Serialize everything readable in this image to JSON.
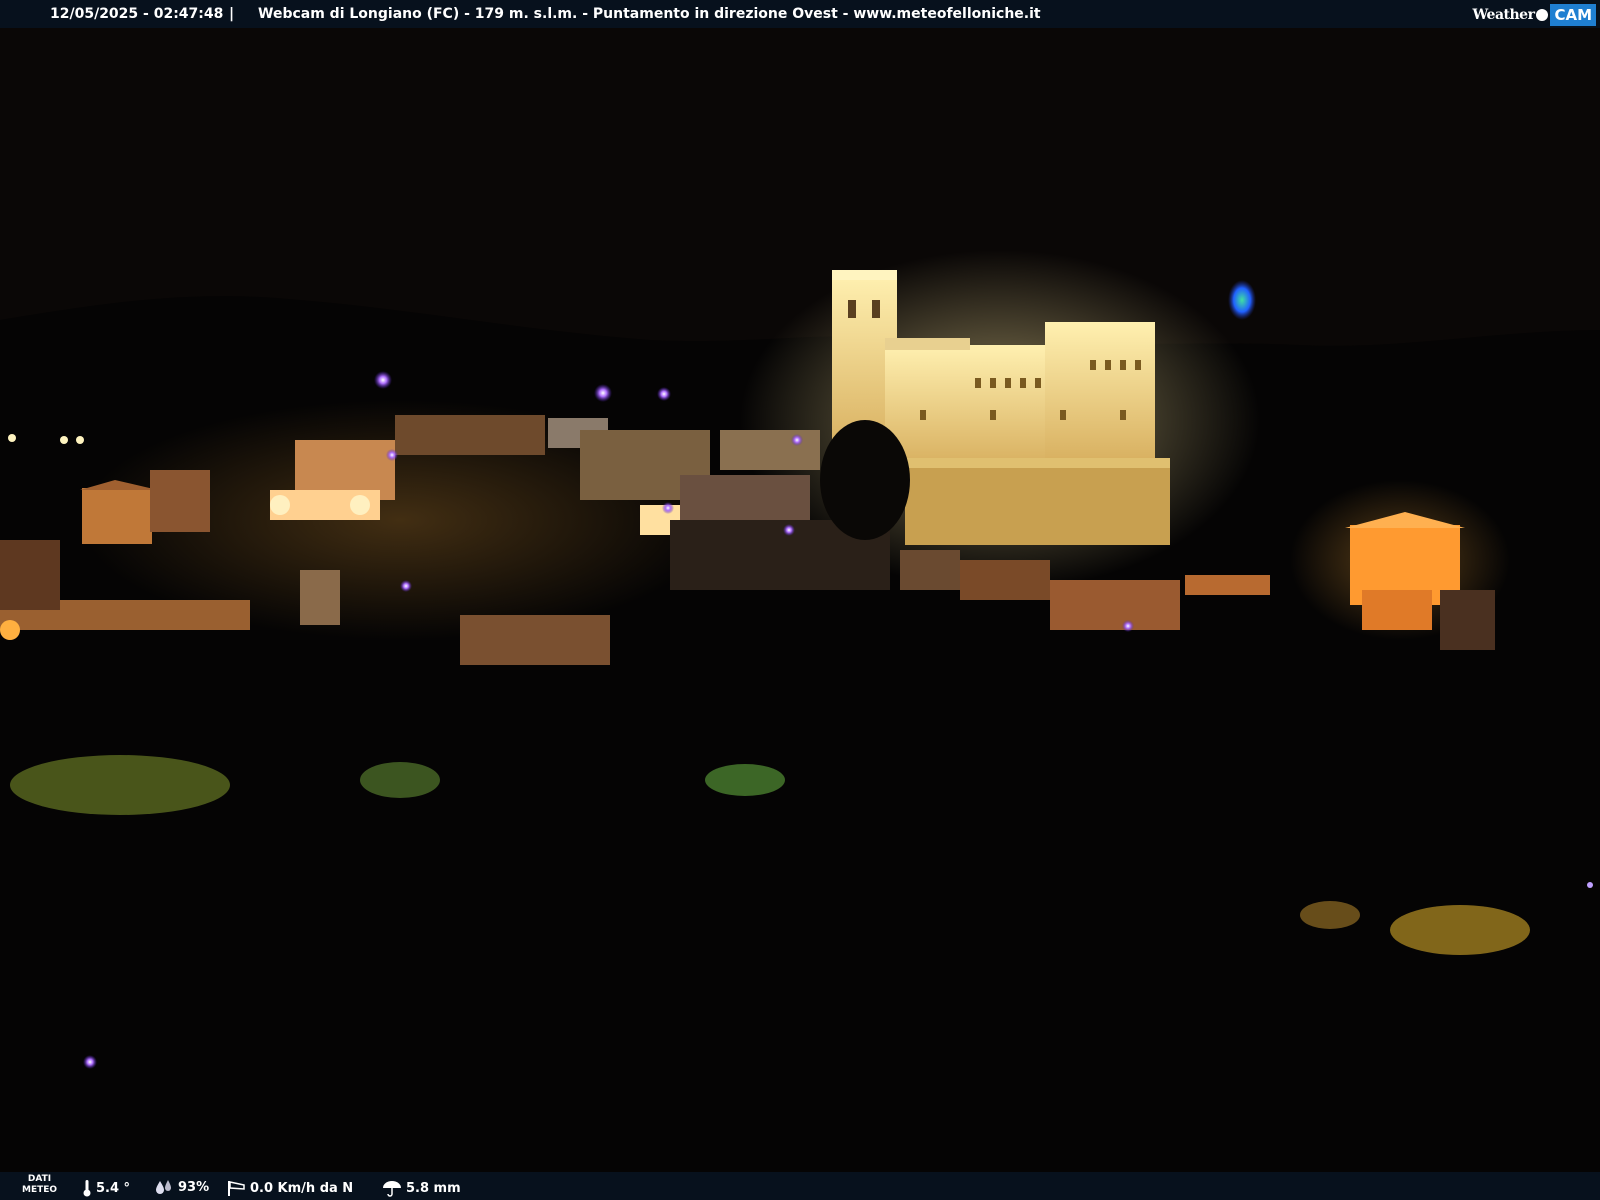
{
  "header": {
    "timestamp": "12/05/2025 - 02:47:48",
    "separator": "|",
    "caption": "Webcam di Longiano (FC) - 179 m. s.l.m. - Puntamento in direzione Ovest - www.meteofelloniche.it",
    "logo_word": "Weather",
    "logo_badge": "CAM"
  },
  "footer": {
    "dati_line1": "DATI",
    "dati_line2": "METEO",
    "temperature": "5.4 °",
    "humidity": "93%",
    "wind": "0.0 Km/h da N",
    "rain": "5.8 mm",
    "icons": [
      "thermometer-icon",
      "humidity-drops-icon",
      "wind-sock-icon",
      "umbrella-icon"
    ]
  },
  "colors": {
    "bar_bg": "#07111d",
    "logo_blue": "#1f7fd1",
    "lit_wall": "#f0d080",
    "warm_light": "#f08a20"
  }
}
